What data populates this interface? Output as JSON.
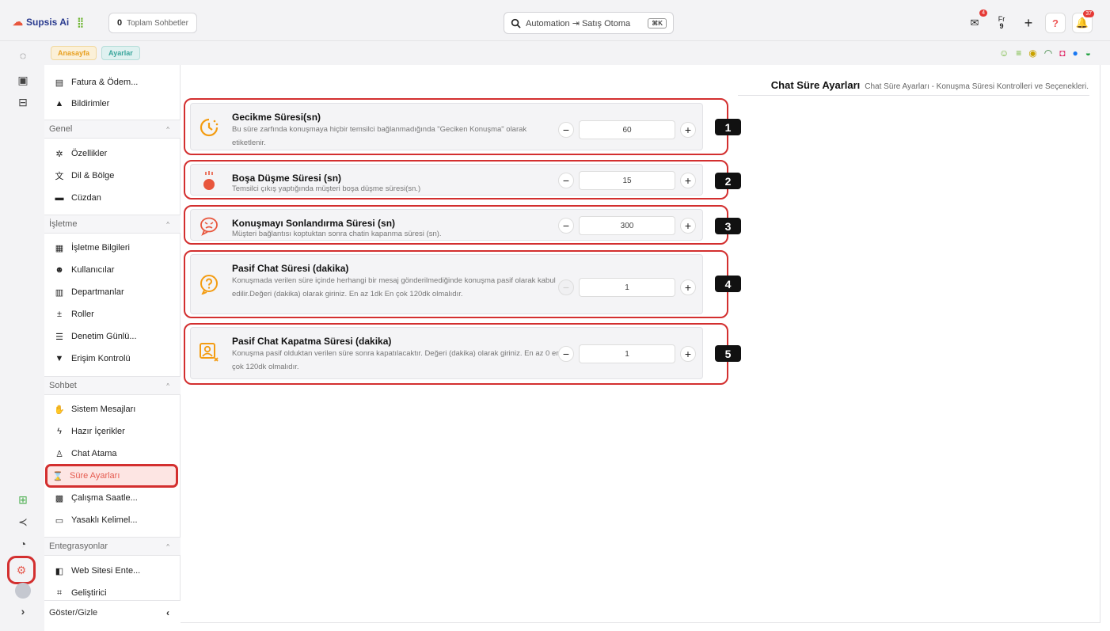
{
  "header": {
    "logo": "Supsis Ai",
    "total_chats_count": "0",
    "total_chats_label": "Toplam Sohbetler",
    "search_value": "Automation ⇥ Satış Otoma",
    "search_shortcut": "⌘K",
    "mail_badge": "4",
    "lang_label": "Fr",
    "lang_sub": "9",
    "bell_badge": "37"
  },
  "tabs": [
    "Anasayfa",
    "Ayarlar"
  ],
  "sidebar": {
    "items_top": [
      {
        "label": "Fatura & Ödem...",
        "icon": "invoice-icon"
      },
      {
        "label": "Bildirimler",
        "icon": "bell-icon"
      }
    ],
    "groups": [
      {
        "title": "Genel",
        "items": [
          "Özellikler",
          "Dil & Bölge",
          "Cüzdan"
        ]
      },
      {
        "title": "İşletme",
        "items": [
          "İşletme Bilgileri",
          "Kullanıcılar",
          "Departmanlar",
          "Roller",
          "Denetim Günlü...",
          "Erişim Kontrolü"
        ]
      },
      {
        "title": "Sohbet",
        "items": [
          "Sistem Mesajları",
          "Hazır İçerikler",
          "Chat Atama",
          "Süre Ayarları",
          "Çalışma Saatle...",
          "Yasaklı Kelimel..."
        ]
      },
      {
        "title": "Entegrasyonlar",
        "items": [
          "Web Sitesi Ente...",
          "Geliştirici"
        ]
      }
    ],
    "footer": "Göster/Gizle"
  },
  "page": {
    "title": "Chat Süre Ayarları",
    "subtitle": "Chat Süre Ayarları - Konuşma Süresi Kontrolleri ve Seçenekleri."
  },
  "settings": [
    {
      "title": "Gecikme Süresi(sn)",
      "desc": "Bu süre zarfında konuşmaya hiçbir temsilci bağlanmadığında \"Geciken Konuşma\" olarak etiketlenir.",
      "value": "60",
      "marker": "1"
    },
    {
      "title": "Boşa Düşme Süresi (sn)",
      "desc": "Temsilci çıkış yaptığında müşteri boşa düşme süresi(sn.)",
      "value": "15",
      "marker": "2"
    },
    {
      "title": "Konuşmayı Sonlandırma Süresi (sn)",
      "desc": "Müşteri bağlantısı koptuktan sonra chatin kapanma süresi (sn).",
      "value": "300",
      "marker": "3"
    },
    {
      "title": "Pasif Chat Süresi (dakika)",
      "desc": "Konuşmada verilen süre içinde herhangi bir mesaj gönderilmediğinde konuşma pasif olarak kabul edilir.Değeri (dakika) olarak giriniz. En az 1dk En çok 120dk olmalıdır.",
      "value": "1",
      "marker": "4"
    },
    {
      "title": "Pasif Chat Kapatma Süresi (dakika)",
      "desc": "Konuşma pasif olduktan verilen süre sonra kapatılacaktır. Değeri (dakika) olarak giriniz. En az 0 en çok 120dk olmalıdır.",
      "value": "1",
      "marker": "5"
    }
  ],
  "colors": {
    "accent": "#f39c12",
    "highlight": "#d32f2f",
    "active_bg": "#fde5e3"
  }
}
